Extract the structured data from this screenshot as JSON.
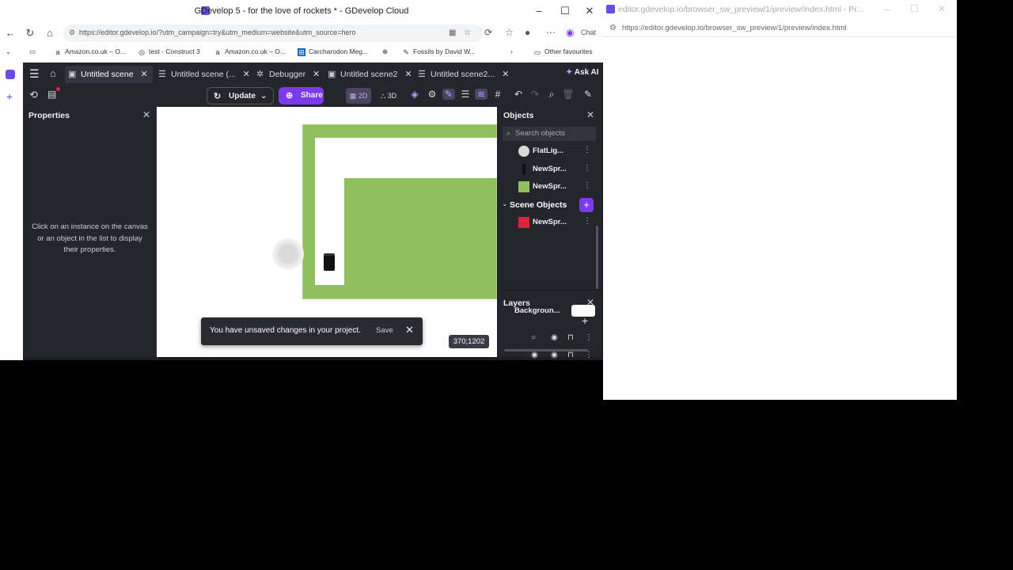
{
  "browser": {
    "title": "GDevelop 5 - for the love of rockets * - GDevelop Cloud",
    "url": "https://editor.gdevelop.io/?utm_campaign=try&utm_medium=website&utm_source=hero",
    "chat_label": "Chat",
    "bookmarks": [
      "Amazon.co.uk – O...",
      "test - Construct 3",
      "Amazon.co.uk – O...",
      "Carcharodon Meg...",
      "Fossils by David W..."
    ],
    "other_favourites": "Other favourites"
  },
  "preview_window": {
    "title": "editor.gdevelop.io/browser_sw_preview/1/preview/index.html - Pr...",
    "url": "https://editor.gdevelop.io/browser_sw_preview/1/preview/index.html"
  },
  "app": {
    "tabs": [
      "Untitled scene",
      "Untitled scene (...",
      "Debugger",
      "Untitled scene2",
      "Untitled scene2..."
    ],
    "ask_ai": "Ask AI",
    "update_label": "Update",
    "share_label": "Share",
    "mode_2d": "2D",
    "mode_3d": "3D"
  },
  "properties": {
    "title": "Properties",
    "hint": "Click on an instance on the canvas or an object in the list to display their properties."
  },
  "objects": {
    "title": "Objects",
    "search_placeholder": "Search objects",
    "global_items": [
      {
        "name": "FlatLig...",
        "color": "#d9d9d9",
        "kind": "circle"
      },
      {
        "name": "NewSpr...",
        "color": "#111111",
        "kind": "phone"
      },
      {
        "name": "NewSpr...",
        "color": "#8fbf5f",
        "kind": "square"
      }
    ],
    "scene_header": "Scene Objects",
    "scene_items": [
      {
        "name": "NewSpr...",
        "color": "#e0233c",
        "kind": "square"
      }
    ]
  },
  "layers": {
    "title": "Layers",
    "background_label": "Backgroun..."
  },
  "snackbar": {
    "message": "You have unsaved changes in your project.",
    "save_label": "Save"
  },
  "coords": "370;1202",
  "colors": {
    "accent": "#7c3aed",
    "canvas_green": "#8fbf5f",
    "panel_bg": "#25252e"
  }
}
